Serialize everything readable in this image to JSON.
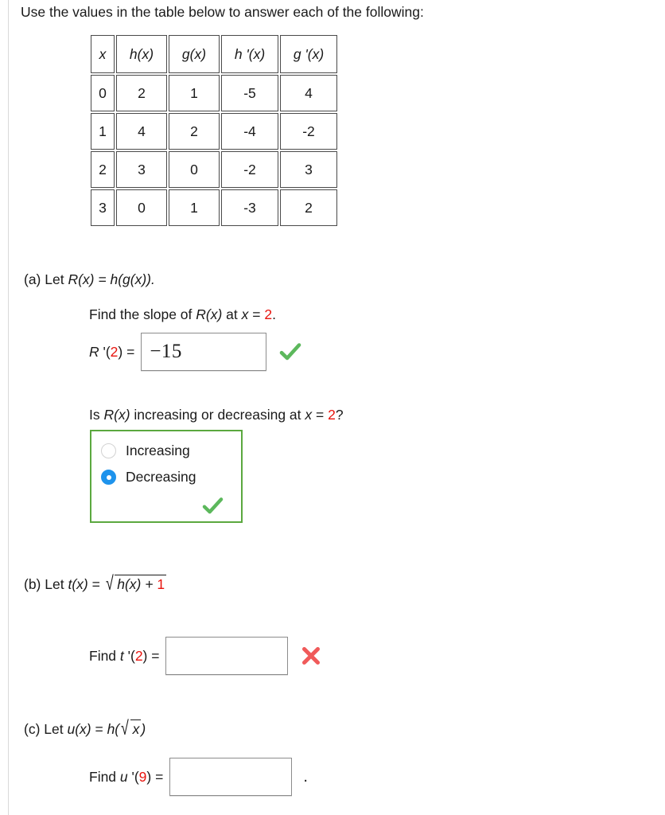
{
  "prompt": "Use the values in the table below to answer each of the following:",
  "table": {
    "headers": [
      "x",
      "h(x)",
      "g(x)",
      "h '(x)",
      "g '(x)"
    ],
    "rows": [
      [
        "0",
        "2",
        "1",
        "-5",
        "4"
      ],
      [
        "1",
        "4",
        "2",
        "-4",
        "-2"
      ],
      [
        "2",
        "3",
        "0",
        "-2",
        "3"
      ],
      [
        "3",
        "0",
        "1",
        "-3",
        "2"
      ]
    ]
  },
  "parts": {
    "a": {
      "letter": "(a)",
      "lead": "Let",
      "definition": "R(x) = h(g(x)).",
      "instruction_pre": "Find the slope of ",
      "instruction_fn": "R(x)",
      "instruction_mid": " at ",
      "instruction_var": "x",
      "instruction_eq": " = ",
      "instruction_value": "2",
      "instruction_end": ".",
      "answer_label_fn": "R",
      "answer_label_prime": " '(",
      "answer_label_value": "2",
      "answer_label_close": ") =",
      "answer_value": "−15",
      "mark": "check-green",
      "question": {
        "text_pre": "Is ",
        "text_fn": "R(x)",
        "text_mid": " increasing or decreasing at ",
        "text_var": "x",
        "text_eq": " = ",
        "text_value": "2",
        "text_end": "?",
        "options": [
          {
            "label": "Increasing",
            "selected": false
          },
          {
            "label": "Decreasing",
            "selected": true
          }
        ],
        "mark": "check-green"
      }
    },
    "b": {
      "letter": "(b)",
      "lead": "Let",
      "fn_name": "t(x)",
      "eq": " = ",
      "radical_symbol": "√",
      "radicand_pre": "h(x) + ",
      "radicand_red": "1",
      "answer_label_pre": "Find ",
      "answer_label_fn": "t",
      "answer_label_prime": " '(",
      "answer_label_value": "2",
      "answer_label_close": ") =",
      "answer_value": "",
      "answer_placeholder": "",
      "mark": "cross-red"
    },
    "c": {
      "letter": "(c)",
      "lead": "Let",
      "fn_name": "u(x)",
      "eq": " = ",
      "outer_fn_open": "h(",
      "radical_symbol": "√",
      "radicand": "x",
      "outer_fn_close": ")",
      "answer_label_pre": "Find ",
      "answer_label_fn": "u",
      "answer_label_prime": " '(",
      "answer_label_value": "9",
      "answer_label_close": ") =",
      "answer_value": "",
      "answer_placeholder": "",
      "trailing": "."
    }
  },
  "colors": {
    "red_accent": "#e8130d",
    "green_check": "#5cb85c",
    "green_border": "#5ba83f",
    "red_cross": "#f05a5a",
    "radio_selected": "#1e93ec",
    "table_border": "#4a4a4a",
    "input_border": "#8c8c8c"
  }
}
